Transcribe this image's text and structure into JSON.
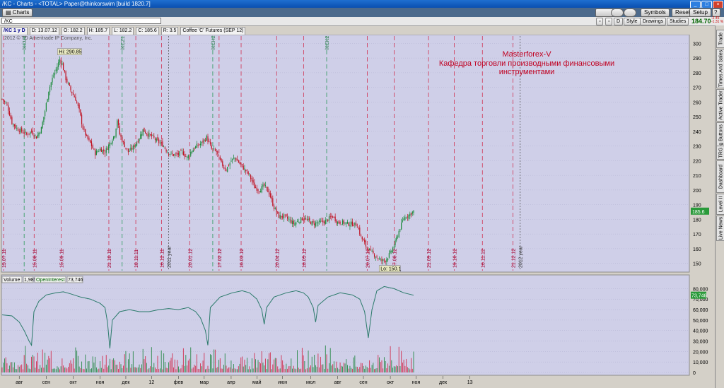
{
  "window": {
    "title": "/KC - Charts - <TOTAL> Paper@thinkorswim [build 1820.7]",
    "tab_label": "Charts"
  },
  "toolbar": {
    "symbols_label": "Symbols",
    "reset_label": "Reset",
    "setup_label": "Setup"
  },
  "header": {
    "symbol_value": "/KC",
    "style_label": "Style",
    "drawings_label": "Drawings",
    "studies_label": "Studies",
    "last_price": "184.70",
    "d_button": "D",
    "change_top": "-2.45",
    "change_bottom": "-1.31 %"
  },
  "infobar": {
    "aggregation": "/KC 1 y D",
    "date": "D: 13.07.12",
    "open": "O: 182.2",
    "high": "H: 185.7",
    "low": "L: 182.2",
    "close": "C: 185.6",
    "range": "R: 3.5",
    "description": "Coffee 'C' Futures (SEP 12)"
  },
  "copyright": "2012 © TD Ameritrade IP Company, Inc.",
  "annotation": {
    "line1": "Masterforex-V",
    "line2": "Кафедра торговли производными финансовыми",
    "line3": "инструментами"
  },
  "sidebar_tabs": [
    "Trade",
    "Times And Sales",
    "Active Trader",
    "Big Buttons",
    "TRG",
    "Dashboard",
    "Level II",
    "Live News"
  ],
  "chart_data": [
    {
      "type": "candlestick",
      "title": "Coffee 'C' Futures (SEP 12)",
      "ylim": [
        145,
        305
      ],
      "y_ticks": [
        150,
        160,
        170,
        180,
        190,
        200,
        210,
        220,
        230,
        240,
        250,
        260,
        270,
        280,
        290,
        300
      ],
      "last_price_label": "185.6",
      "high_label": "Hi: 290.85",
      "low_label": "Lo: 150.1",
      "x_date_labels": [
        "15.07.11",
        "15.08.11",
        "15.09.11",
        "21.10.11",
        "18.11.11",
        "16.12.11",
        "20.01.12",
        "17.02.12",
        "16.03.12",
        "20.04.12",
        "18.05.12",
        "20.07.12",
        "17.08.12",
        "21.09.12",
        "19.10.12",
        "16.11.12",
        "21.12.12"
      ],
      "year_labels": [
        "2011 year",
        "2012 year"
      ],
      "expiry_labels": [
        "/KCU1",
        "/KCZ1",
        "/KCH2",
        "/KCK2"
      ],
      "x_month_labels": [
        "авг",
        "сен",
        "окт",
        "ноя",
        "дек",
        "12",
        "фев",
        "мар",
        "апр",
        "май",
        "июн",
        "июл",
        "авг",
        "сен",
        "окт",
        "ноя",
        "дек",
        "13"
      ],
      "close_path": [
        [
          0,
          262
        ],
        [
          4,
          258
        ],
        [
          8,
          246
        ],
        [
          12,
          242
        ],
        [
          16,
          240
        ],
        [
          20,
          238
        ],
        [
          24,
          240
        ],
        [
          28,
          236
        ],
        [
          32,
          242
        ],
        [
          35,
          254
        ],
        [
          38,
          268
        ],
        [
          41,
          276
        ],
        [
          44,
          282
        ],
        [
          47,
          289
        ],
        [
          49,
          286
        ],
        [
          52,
          276
        ],
        [
          56,
          268
        ],
        [
          60,
          262
        ],
        [
          63,
          254
        ],
        [
          66,
          242
        ],
        [
          69,
          236
        ],
        [
          72,
          232
        ],
        [
          76,
          225
        ],
        [
          80,
          228
        ],
        [
          84,
          226
        ],
        [
          88,
          232
        ],
        [
          92,
          238
        ],
        [
          94,
          248
        ],
        [
          96,
          238
        ],
        [
          99,
          232
        ],
        [
          103,
          226
        ],
        [
          107,
          229
        ],
        [
          111,
          234
        ],
        [
          115,
          241
        ],
        [
          119,
          238
        ],
        [
          123,
          236
        ],
        [
          127,
          233
        ],
        [
          131,
          231
        ],
        [
          135,
          226
        ],
        [
          139,
          224
        ],
        [
          143,
          224
        ],
        [
          147,
          226
        ],
        [
          151,
          222
        ],
        [
          155,
          227
        ],
        [
          159,
          230
        ],
        [
          163,
          232
        ],
        [
          167,
          236
        ],
        [
          171,
          228
        ],
        [
          175,
          226
        ],
        [
          179,
          218
        ],
        [
          183,
          214
        ],
        [
          187,
          220
        ],
        [
          190,
          222
        ],
        [
          194,
          218
        ],
        [
          198,
          214
        ],
        [
          202,
          210
        ],
        [
          206,
          202
        ],
        [
          210,
          200
        ],
        [
          214,
          203
        ],
        [
          218,
          198
        ],
        [
          222,
          188
        ],
        [
          226,
          182
        ],
        [
          230,
          182
        ],
        [
          234,
          180
        ],
        [
          238,
          177
        ],
        [
          242,
          179
        ],
        [
          246,
          181
        ],
        [
          250,
          179
        ],
        [
          254,
          177
        ],
        [
          258,
          178
        ],
        [
          262,
          178
        ],
        [
          266,
          180
        ],
        [
          270,
          182
        ],
        [
          274,
          178
        ],
        [
          278,
          178
        ],
        [
          282,
          177
        ],
        [
          286,
          177
        ],
        [
          290,
          176
        ],
        [
          293,
          168
        ],
        [
          297,
          162
        ],
        [
          301,
          158
        ],
        [
          305,
          155
        ],
        [
          309,
          152
        ],
        [
          313,
          152
        ],
        [
          317,
          157
        ],
        [
          320,
          162
        ],
        [
          324,
          172
        ],
        [
          328,
          181
        ],
        [
          332,
          183
        ],
        [
          336,
          185.6
        ]
      ]
    },
    {
      "type": "bar",
      "series": [
        {
          "name": "Volume",
          "label_value": "1,985"
        },
        {
          "name": "OpenInterest",
          "label_value": "73,746",
          "type": "line"
        }
      ],
      "ylim": [
        0,
        85000
      ],
      "y_ticks": [
        "0",
        "10,000",
        "20,000",
        "30,000",
        "40,000",
        "50,000",
        "60,000",
        "70,000",
        "80,000"
      ],
      "open_interest_path": [
        [
          0,
          55000
        ],
        [
          8,
          54000
        ],
        [
          14,
          48000
        ],
        [
          18,
          40000
        ],
        [
          22,
          30000
        ],
        [
          24,
          26000
        ],
        [
          26,
          58000
        ],
        [
          30,
          68000
        ],
        [
          36,
          74000
        ],
        [
          44,
          76000
        ],
        [
          50,
          77000
        ],
        [
          56,
          75000
        ],
        [
          64,
          72000
        ],
        [
          72,
          70000
        ],
        [
          80,
          66000
        ],
        [
          84,
          62000
        ],
        [
          86,
          48000
        ],
        [
          88,
          23000
        ],
        [
          90,
          50000
        ],
        [
          96,
          58000
        ],
        [
          104,
          60000
        ],
        [
          112,
          58000
        ],
        [
          120,
          58000
        ],
        [
          128,
          60000
        ],
        [
          136,
          61000
        ],
        [
          144,
          60000
        ],
        [
          152,
          62000
        ],
        [
          158,
          58000
        ],
        [
          162,
          52000
        ],
        [
          166,
          40000
        ],
        [
          168,
          26000
        ],
        [
          170,
          62000
        ],
        [
          178,
          72000
        ],
        [
          188,
          76000
        ],
        [
          196,
          78000
        ],
        [
          202,
          76000
        ],
        [
          208,
          70000
        ],
        [
          212,
          60000
        ],
        [
          214,
          46000
        ],
        [
          216,
          62000
        ],
        [
          222,
          72000
        ],
        [
          232,
          76000
        ],
        [
          240,
          78000
        ],
        [
          246,
          76000
        ],
        [
          250,
          72000
        ],
        [
          254,
          62000
        ],
        [
          256,
          48000
        ],
        [
          258,
          64000
        ],
        [
          266,
          72000
        ],
        [
          276,
          76000
        ],
        [
          286,
          74000
        ],
        [
          292,
          70000
        ],
        [
          296,
          58000
        ],
        [
          299,
          33000
        ],
        [
          302,
          60000
        ],
        [
          306,
          78000
        ],
        [
          312,
          82000
        ],
        [
          320,
          80000
        ],
        [
          328,
          76000
        ],
        [
          336,
          73746
        ]
      ]
    }
  ]
}
